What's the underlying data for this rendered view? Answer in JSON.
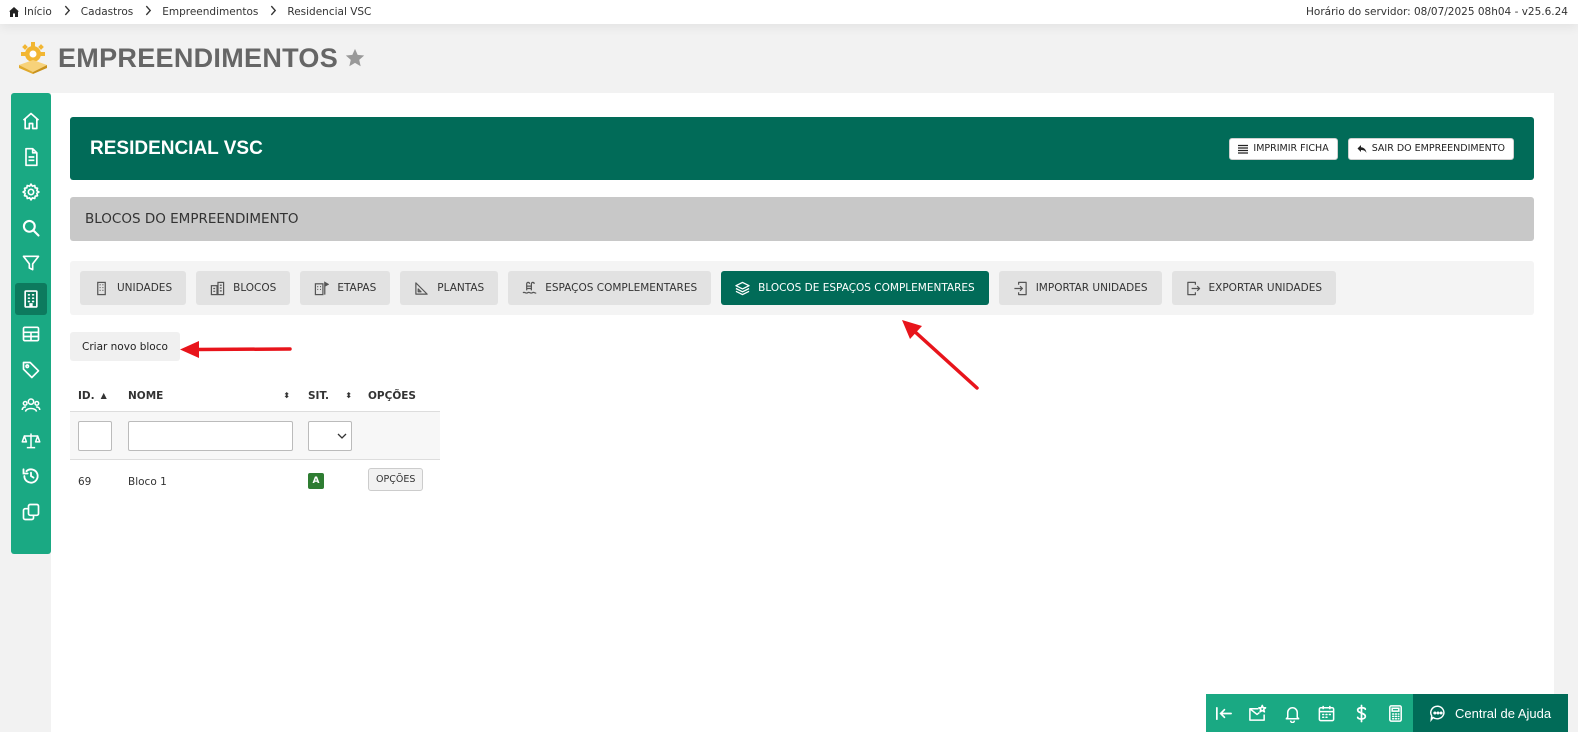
{
  "breadcrumb": {
    "items": [
      "Início",
      "Cadastros",
      "Empreendimentos",
      "Residencial VSC"
    ],
    "server_info": "Horário do servidor: 08/07/2025 08h04 - v25.6.24"
  },
  "header": {
    "title": "EMPREENDIMENTOS",
    "logo_icon": "gear-building-icon",
    "favorite_icon": "star-icon"
  },
  "sidebar": {
    "items": [
      {
        "icon": "home-icon"
      },
      {
        "icon": "document-icon"
      },
      {
        "icon": "gear-icon"
      },
      {
        "icon": "search-icon"
      },
      {
        "icon": "filter-icon"
      },
      {
        "icon": "building-icon",
        "active": true
      },
      {
        "icon": "table-icon"
      },
      {
        "icon": "tag-icon"
      },
      {
        "icon": "users-icon"
      },
      {
        "icon": "scale-icon"
      },
      {
        "icon": "history-icon"
      },
      {
        "icon": "copy-icon"
      }
    ]
  },
  "banner": {
    "title": "RESIDENCIAL VSC",
    "print_label": "IMPRIMIR FICHA",
    "exit_label": "SAIR DO EMPREENDIMENTO"
  },
  "section": {
    "title": "BLOCOS DO EMPREENDIMENTO"
  },
  "tabs": [
    {
      "label": "UNIDADES",
      "icon": "building-icon"
    },
    {
      "label": "BLOCOS",
      "icon": "buildings-icon"
    },
    {
      "label": "ETAPAS",
      "icon": "building-flag-icon"
    },
    {
      "label": "PLANTAS",
      "icon": "triangle-ruler-icon"
    },
    {
      "label": "ESPAÇOS COMPLEMENTARES",
      "icon": "pool-icon"
    },
    {
      "label": "BLOCOS DE ESPAÇOS COMPLEMENTARES",
      "icon": "layers-icon",
      "active": true
    },
    {
      "label": "IMPORTAR UNIDADES",
      "icon": "import-icon"
    },
    {
      "label": "EXPORTAR UNIDADES",
      "icon": "export-icon"
    }
  ],
  "actions": {
    "create_label": "Criar novo bloco"
  },
  "table": {
    "columns": [
      "ID.",
      "NOME",
      "SIT.",
      "OPÇÕES"
    ],
    "rows": [
      {
        "id": "69",
        "nome": "Bloco 1",
        "sit": "A",
        "options": "OPÇÕES"
      }
    ]
  },
  "bottom_bar": {
    "icons": [
      "collapse-left-icon",
      "mail-star-icon",
      "bell-icon",
      "calendar-icon",
      "dollar-icon",
      "calculator-icon"
    ],
    "help_label": "Central de Ajuda"
  },
  "colors": {
    "primary_dark": "#016b58",
    "primary": "#1aa983",
    "annotation": "#e8141b"
  }
}
